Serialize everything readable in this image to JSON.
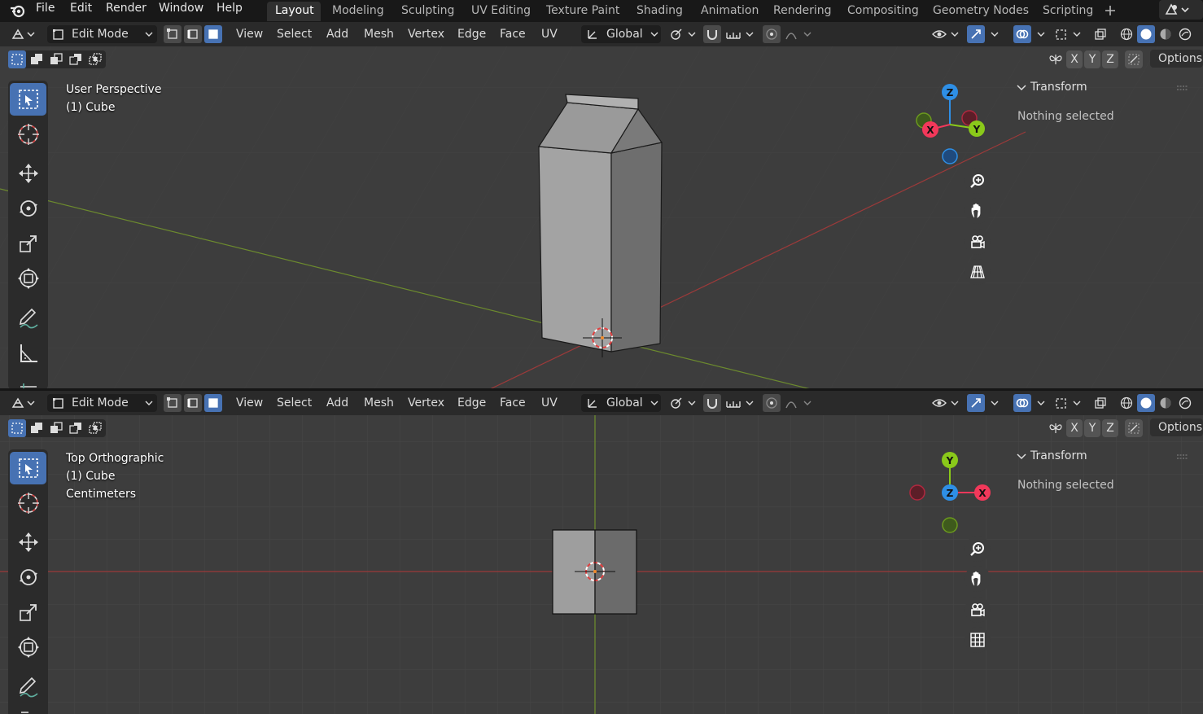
{
  "app": {
    "menus": [
      "File",
      "Edit",
      "Render",
      "Window",
      "Help"
    ],
    "workspaces": [
      "Layout",
      "Modeling",
      "Sculpting",
      "UV Editing",
      "Texture Paint",
      "Shading",
      "Animation",
      "Rendering",
      "Compositing",
      "Geometry Nodes",
      "Scripting"
    ],
    "active_workspace": "Layout",
    "add_workspace_icon": "plus-icon"
  },
  "header": {
    "mode": "Edit Mode",
    "menus": [
      "View",
      "Select",
      "Add",
      "Mesh",
      "Vertex",
      "Edge",
      "Face",
      "UV"
    ],
    "orientation": "Global",
    "options_label": "Options",
    "axis_x": "X",
    "axis_y": "Y",
    "axis_z": "Z"
  },
  "viewport_top": {
    "view_name": "User Perspective",
    "object": "(1) Cube"
  },
  "viewport_bottom": {
    "view_name": "Top Orthographic",
    "object": "(1) Cube",
    "units": "Centimeters"
  },
  "sidebar": {
    "title": "Transform",
    "status": "Nothing selected"
  },
  "gizmo": {
    "x_label": "X",
    "y_label": "Y",
    "z_label": "Z",
    "x_color": "#f2385a",
    "y_color": "#8ac91a",
    "z_color": "#2e8fe6"
  },
  "colors": {
    "accent": "#4772b3",
    "viewport_bg": "#3d3d3d",
    "grid_line": "#474747",
    "axis_red": "#9b3a3a",
    "axis_green": "#6c8a2e"
  }
}
